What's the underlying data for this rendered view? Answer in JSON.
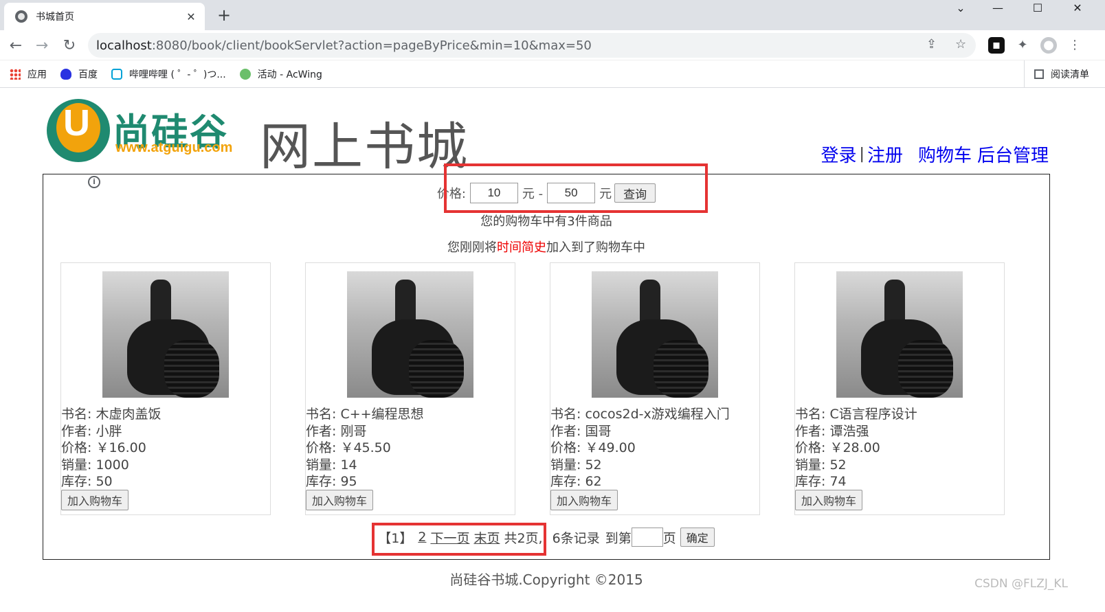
{
  "browser": {
    "tab_title": "书城首页",
    "tab_close": "✕",
    "new_tab": "+",
    "url_host": "localhost",
    "url_rest": ":8080/book/client/bookServlet?action=pageByPrice&min=10&max=50",
    "bookmarks": [
      {
        "label": "应用",
        "icon": "apps-icon"
      },
      {
        "label": "百度",
        "icon": "baidu-icon"
      },
      {
        "label": "哔哩哔哩 ( ゜- ゜)つ...",
        "icon": "bilibili-icon"
      },
      {
        "label": "活动 - AcWing",
        "icon": "acwing-icon"
      }
    ],
    "reading_list": "阅读清单"
  },
  "header": {
    "logo_cn": "尚硅谷",
    "logo_web": "www.atguigu.com",
    "site_title": "网上书城",
    "links": {
      "login": "登录",
      "sep": "|",
      "register": "注册",
      "cart": "购物车",
      "admin": "后台管理"
    }
  },
  "search": {
    "label": "价格:",
    "min": "10",
    "unit1": "元 -",
    "max": "50",
    "unit2": "元",
    "button": "查询"
  },
  "cart_info": "您的购物车中有3件商品",
  "last_added": {
    "prefix": "您刚刚将",
    "book": "时间简史",
    "suffix": "加入到了购物车中"
  },
  "books": [
    {
      "name": "书名: 木虚肉盖饭",
      "author": "作者: 小胖",
      "price": "价格: ￥16.00",
      "sales": "销量: 1000",
      "stock": "库存: 50",
      "button": "加入购物车"
    },
    {
      "name": "书名: C++编程思想",
      "author": "作者: 刚哥",
      "price": "价格: ￥45.50",
      "sales": "销量: 14",
      "stock": "库存: 95",
      "button": "加入购物车"
    },
    {
      "name": "书名: cocos2d-x游戏编程入门",
      "author": "作者: 国哥",
      "price": "价格: ￥49.00",
      "sales": "销量: 52",
      "stock": "库存: 62",
      "button": "加入购物车"
    },
    {
      "name": "书名: C语言程序设计",
      "author": "作者: 谭浩强",
      "price": "价格: ￥28.00",
      "sales": "销量: 52",
      "stock": "库存: 74",
      "button": "加入购物车"
    }
  ],
  "pager": {
    "current": "【1】",
    "page2": "2",
    "next": "下一页",
    "last": "末页",
    "total_pages": "共2页,",
    "total_records": "6条记录",
    "goto_prefix": "到第",
    "goto_suffix": "页",
    "confirm": "确定"
  },
  "footer": "尚硅谷书城.Copyright ©2015",
  "watermark": "CSDN @FLZJ_KL",
  "colors": {
    "highlight_box": "#e53333",
    "link": "#0000ee",
    "recent_book": "#e00000"
  }
}
